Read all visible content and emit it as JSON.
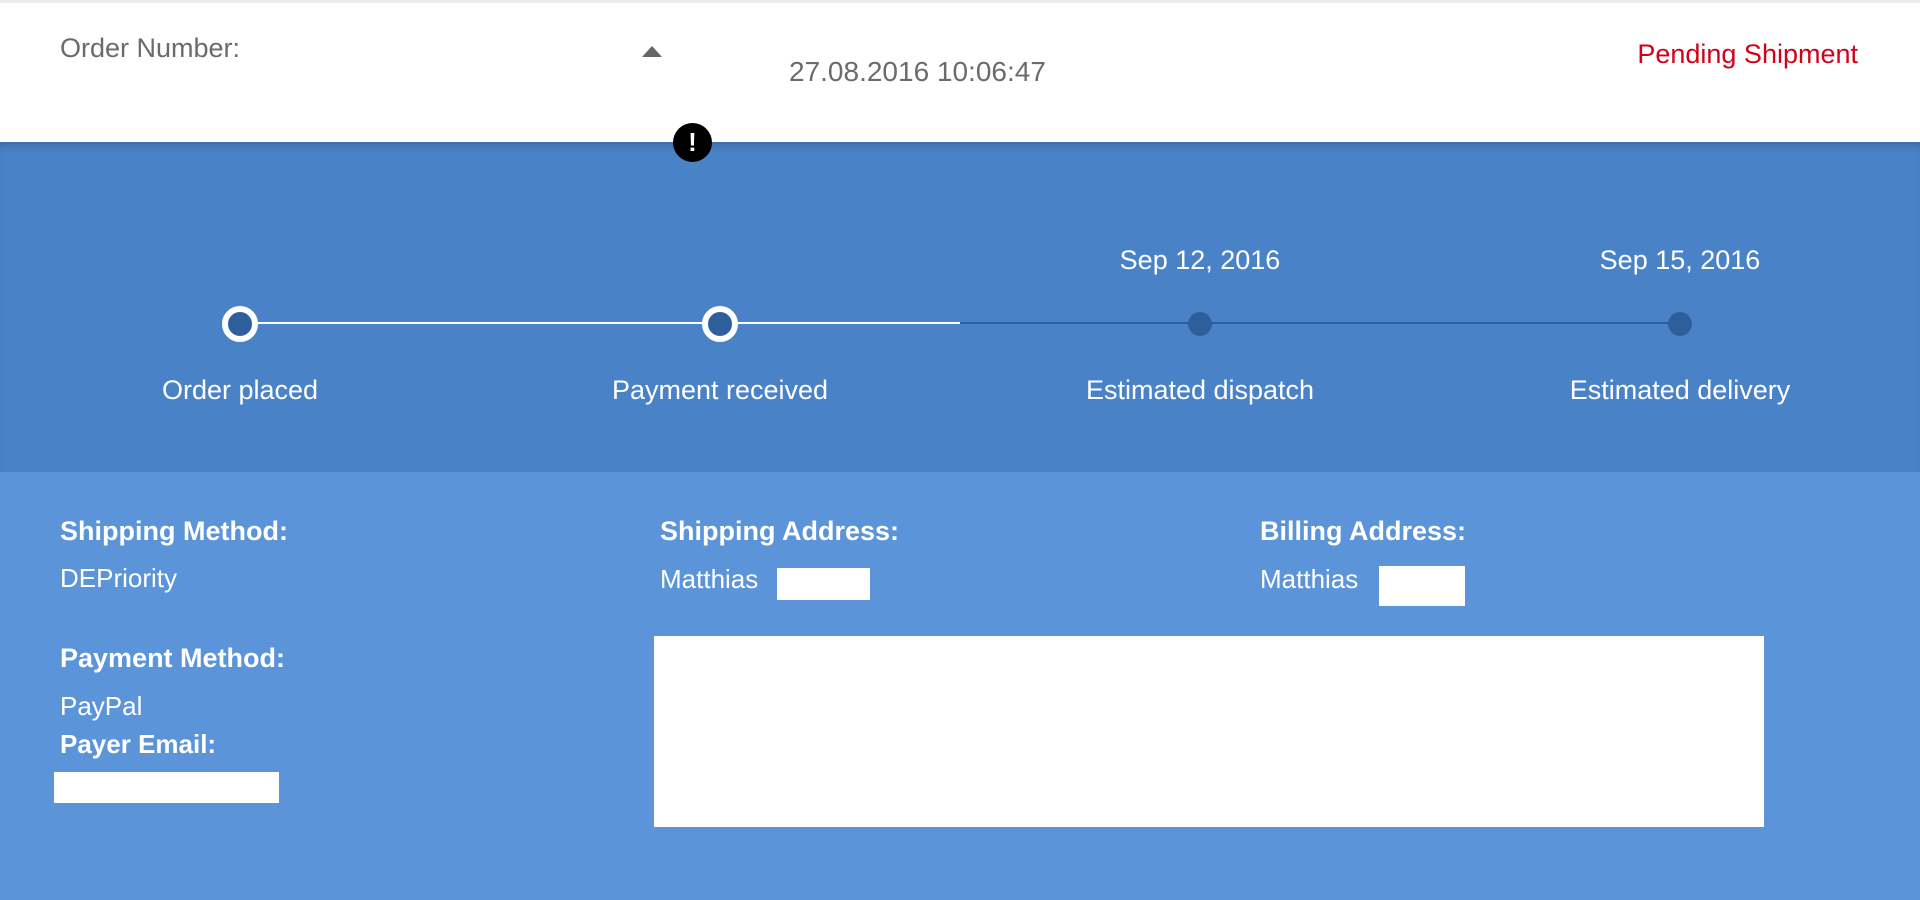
{
  "header": {
    "order_label": "Order Number:",
    "timestamp": "27.08.2016 10:06:47",
    "status": "Pending Shipment",
    "status_color": "#d0021b",
    "caret_icon": "caret-up-icon",
    "alert_icon": "!"
  },
  "tracker": {
    "steps": [
      {
        "label": "Order placed",
        "date": "",
        "state": "completed"
      },
      {
        "label": "Payment received",
        "date": "",
        "state": "completed"
      },
      {
        "label": "Estimated dispatch",
        "date": "Sep 12, 2016",
        "state": "pending"
      },
      {
        "label": "Estimated delivery",
        "date": "Sep 15, 2016",
        "state": "pending"
      }
    ]
  },
  "details": {
    "shipping_method": {
      "heading": "Shipping Method:",
      "value": "DEPriority"
    },
    "payment_method": {
      "heading": "Payment Method:",
      "value": "PayPal"
    },
    "payer_email": {
      "heading": "Payer Email:"
    },
    "shipping_address": {
      "heading": "Shipping Address:",
      "name": "Matthias"
    },
    "billing_address": {
      "heading": "Billing Address:",
      "name": "Matthias"
    }
  },
  "colors": {
    "tracker_bg": "#4a82c8",
    "details_bg": "#5b94d8",
    "pending_node": "#2d5f9c"
  }
}
